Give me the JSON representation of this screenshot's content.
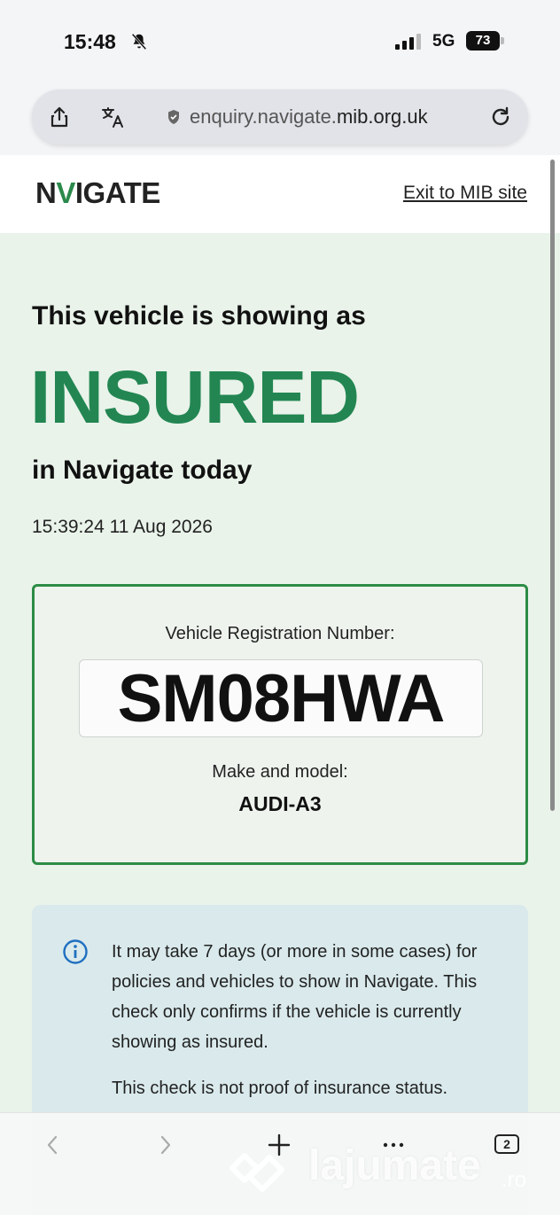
{
  "status_bar": {
    "time": "15:48",
    "network": "5G",
    "battery": "73"
  },
  "browser": {
    "url_prefix": "enquiry.navigate.",
    "url_domain": "mib.org.uk",
    "tabs_count": "2"
  },
  "header": {
    "logo_pre": "N",
    "logo_v": "V",
    "logo_post": "IGATE",
    "logo_a": "A",
    "exit_link": "Exit to MIB site"
  },
  "result": {
    "lead": "This vehicle is showing as",
    "status": "INSURED",
    "sub": "in Navigate today",
    "timestamp": "15:39:24 11 Aug 2026",
    "status_color": "#238652"
  },
  "vehicle": {
    "reg_label": "Vehicle Registration Number:",
    "reg_number": "SM08HWA",
    "make_label": "Make and model:",
    "make_value": "AUDI-A3"
  },
  "info": {
    "text": "It may take 7 days (or more in some cases) for policies and vehicles to show in Navigate. This check only confirms if the vehicle is currently showing as insured.",
    "text2": "This check is not proof of insurance status."
  },
  "watermark": {
    "text": "lajumate",
    "suffix": ".ro"
  }
}
